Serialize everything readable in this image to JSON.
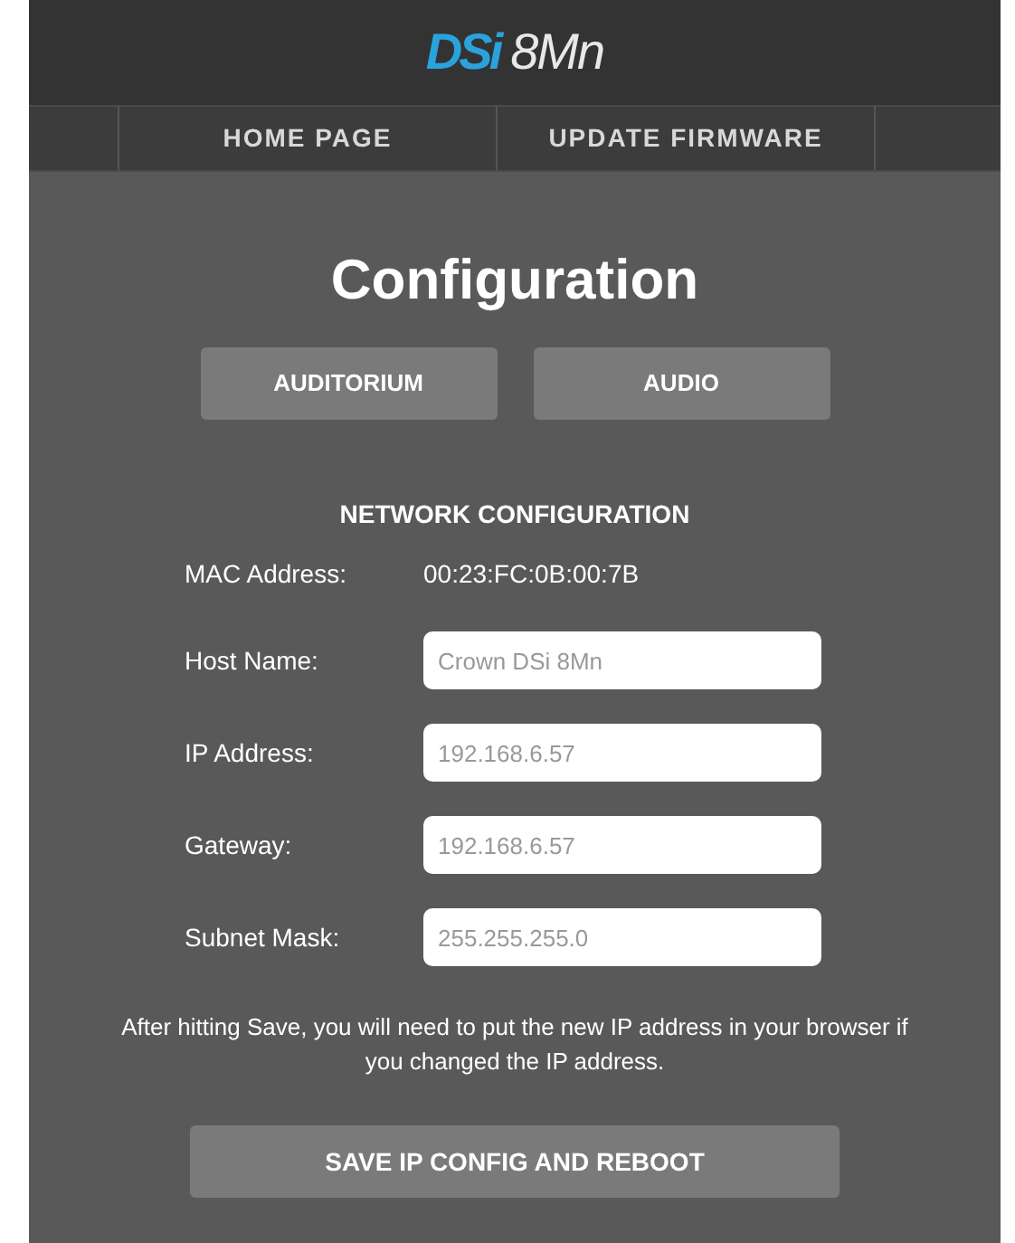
{
  "logo": {
    "brand": "DSi",
    "model": "8Mn"
  },
  "nav": [
    {
      "label": "HOME PAGE"
    },
    {
      "label": "UPDATE FIRMWARE"
    }
  ],
  "title": "Configuration",
  "sections": [
    {
      "label": "AUDITORIUM"
    },
    {
      "label": "AUDIO"
    }
  ],
  "network": {
    "heading": "NETWORK CONFIGURATION",
    "mac": {
      "label": "MAC Address:",
      "value": "00:23:FC:0B:00:7B"
    },
    "fields": [
      {
        "label": "Host Name:",
        "value": "Crown DSi 8Mn"
      },
      {
        "label": "IP Address:",
        "value": "192.168.6.57"
      },
      {
        "label": "Gateway:",
        "value": "192.168.6.57"
      },
      {
        "label": "Subnet Mask:",
        "value": "255.255.255.0"
      }
    ],
    "note": "After hitting Save, you will need to put the new IP address in your browser if you changed the IP address.",
    "save_button": "SAVE IP CONFIG AND REBOOT"
  }
}
